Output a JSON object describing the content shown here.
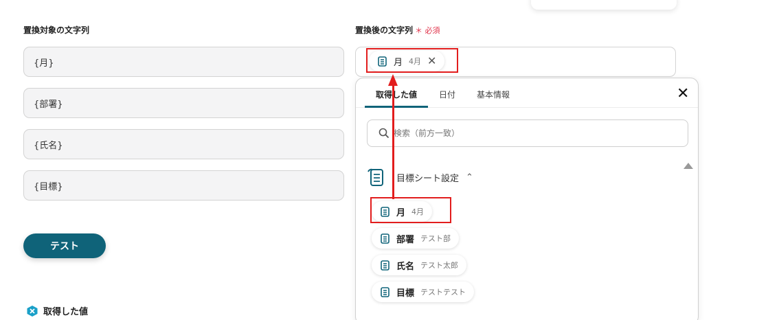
{
  "left": {
    "label": "置換対象の文字列",
    "fields": [
      "{月}",
      "{部署}",
      "{氏名}",
      "{目標}"
    ]
  },
  "right": {
    "label": "置換後の文字列",
    "required_mark": "＊ 必須",
    "selected_chip": {
      "name": "月",
      "value": "4月"
    }
  },
  "test_button": "テスト",
  "acquired_label": "取得した値",
  "panel": {
    "tabs": [
      "取得した値",
      "日付",
      "基本情報"
    ],
    "search_placeholder": "検索（前方一致）",
    "group_name": "目標シート設定",
    "items": [
      {
        "name": "月",
        "value": "4月"
      },
      {
        "name": "部署",
        "value": "テスト部"
      },
      {
        "name": "氏名",
        "value": "テスト太郎"
      },
      {
        "name": "目標",
        "value": "テストテスト"
      }
    ]
  },
  "colors": {
    "accent": "#0f6379",
    "highlight": "#e21d1d",
    "required": "#e0344b"
  }
}
